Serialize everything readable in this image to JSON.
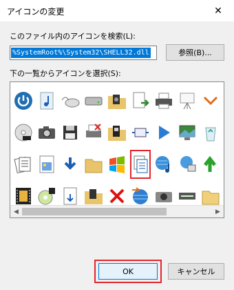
{
  "window": {
    "title": "アイコンの変更",
    "close_glyph": "✕"
  },
  "file_label": "このファイル内のアイコンを検索(L):",
  "file_path": "%SystemRoot%\\System32\\SHELL32.dll",
  "browse_label": "参照(B)...",
  "list_label": "下の一覧からアイコンを選択(S):",
  "icons": [
    {
      "name": "power-icon"
    },
    {
      "name": "music-note-icon"
    },
    {
      "name": "mouse-icon"
    },
    {
      "name": "drive-icon"
    },
    {
      "name": "folder-music-icon"
    },
    {
      "name": "document-arrow-icon"
    },
    {
      "name": "printer-icon"
    },
    {
      "name": "presentation-icon"
    },
    {
      "name": "chevron-icon"
    },
    {
      "name": "dvd-icon"
    },
    {
      "name": "camera-icon"
    },
    {
      "name": "floppy-icon"
    },
    {
      "name": "printer-x-icon"
    },
    {
      "name": "folder-film-icon"
    },
    {
      "name": "monitor-arrows-icon"
    },
    {
      "name": "play-icon"
    },
    {
      "name": "computer-picture-icon"
    },
    {
      "name": "recycle-bin-icon"
    },
    {
      "name": "documents-icon"
    },
    {
      "name": "picture-doc-icon"
    },
    {
      "name": "download-arrow-icon"
    },
    {
      "name": "folder-icon"
    },
    {
      "name": "windows-flag-icon"
    },
    {
      "name": "copy-pages-icon"
    },
    {
      "name": "globe-music-icon"
    },
    {
      "name": "globe-network-icon"
    },
    {
      "name": "green-arrow-icon"
    },
    {
      "name": "film-strip-icon"
    },
    {
      "name": "cd-burn-icon"
    },
    {
      "name": "doc-arrow-down-icon"
    },
    {
      "name": "folder-picture-icon"
    },
    {
      "name": "red-x-icon"
    },
    {
      "name": "globe-arrow-icon"
    },
    {
      "name": "camera2-icon"
    },
    {
      "name": "scanner-icon"
    },
    {
      "name": "folder-plain-icon"
    }
  ],
  "selected_index": 23,
  "ok_label": "OK",
  "cancel_label": "キャンセル",
  "colors": {
    "accent": "#0078d7",
    "highlight": "#e3242b"
  }
}
